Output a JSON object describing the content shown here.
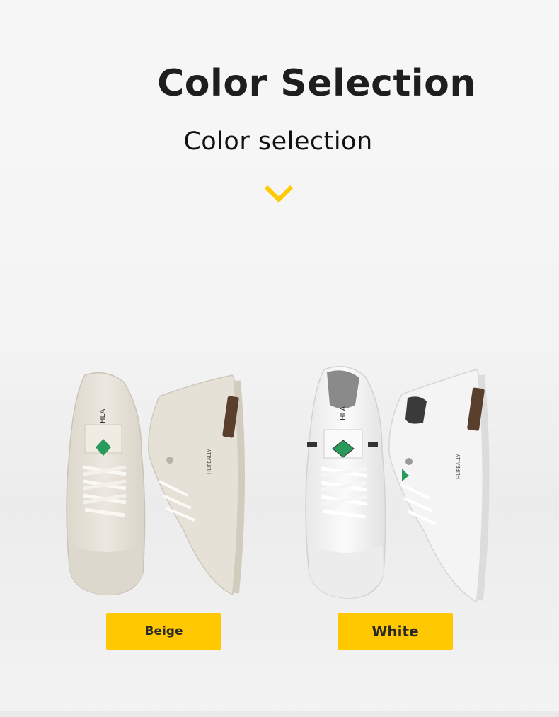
{
  "header": {
    "title": "Color Selection",
    "subtitle": "Color selection",
    "chevron_icon": "chevron-down-icon",
    "accent": "#ffc800"
  },
  "products": [
    {
      "label": "Beige",
      "color": "#e9e4da",
      "brand_tag": "HLIFEALLY",
      "tongue_text": "HLA"
    },
    {
      "label": "White",
      "color": "#f6f6f6",
      "brand_tag": "HLIFEALLY",
      "tongue_text": "HLA"
    }
  ]
}
